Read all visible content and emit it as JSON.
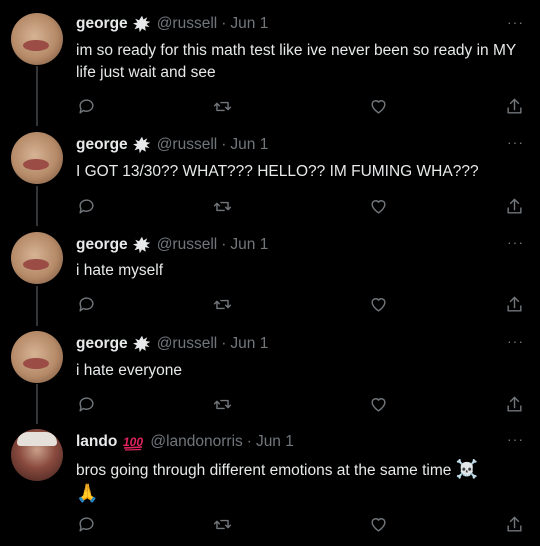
{
  "colors": {
    "background": "#000000",
    "text": "#e7e9ea",
    "muted": "#71767b",
    "badge100": "#e0245e"
  },
  "icons": {
    "reply": "reply-icon",
    "retweet": "retweet-icon",
    "like": "heart-icon",
    "share": "share-icon",
    "more": "more-icon"
  },
  "tweets": [
    {
      "name": "george",
      "handle": "@russell",
      "sep": "·",
      "date": "Jun 1",
      "more": "···",
      "text": "im so ready for this math test like ive never been so ready in MY life just wait and see"
    },
    {
      "name": "george",
      "handle": "@russell",
      "sep": "·",
      "date": "Jun 1",
      "more": "···",
      "text": "I GOT 13/30?? WHAT??? HELLO?? IM FUMING WHA???"
    },
    {
      "name": "george",
      "handle": "@russell",
      "sep": "·",
      "date": "Jun 1",
      "more": "···",
      "text": "i hate myself"
    },
    {
      "name": "george",
      "handle": "@russell",
      "sep": "·",
      "date": "Jun 1",
      "more": "···",
      "text": "i hate everyone"
    },
    {
      "name": "lando",
      "handle": "@landonorris",
      "sep": "·",
      "date": "Jun 1",
      "more": "···",
      "text": "bros going through different emotions at the same time",
      "emoji_line": "🙏",
      "emoji_inline": "☠️"
    }
  ]
}
